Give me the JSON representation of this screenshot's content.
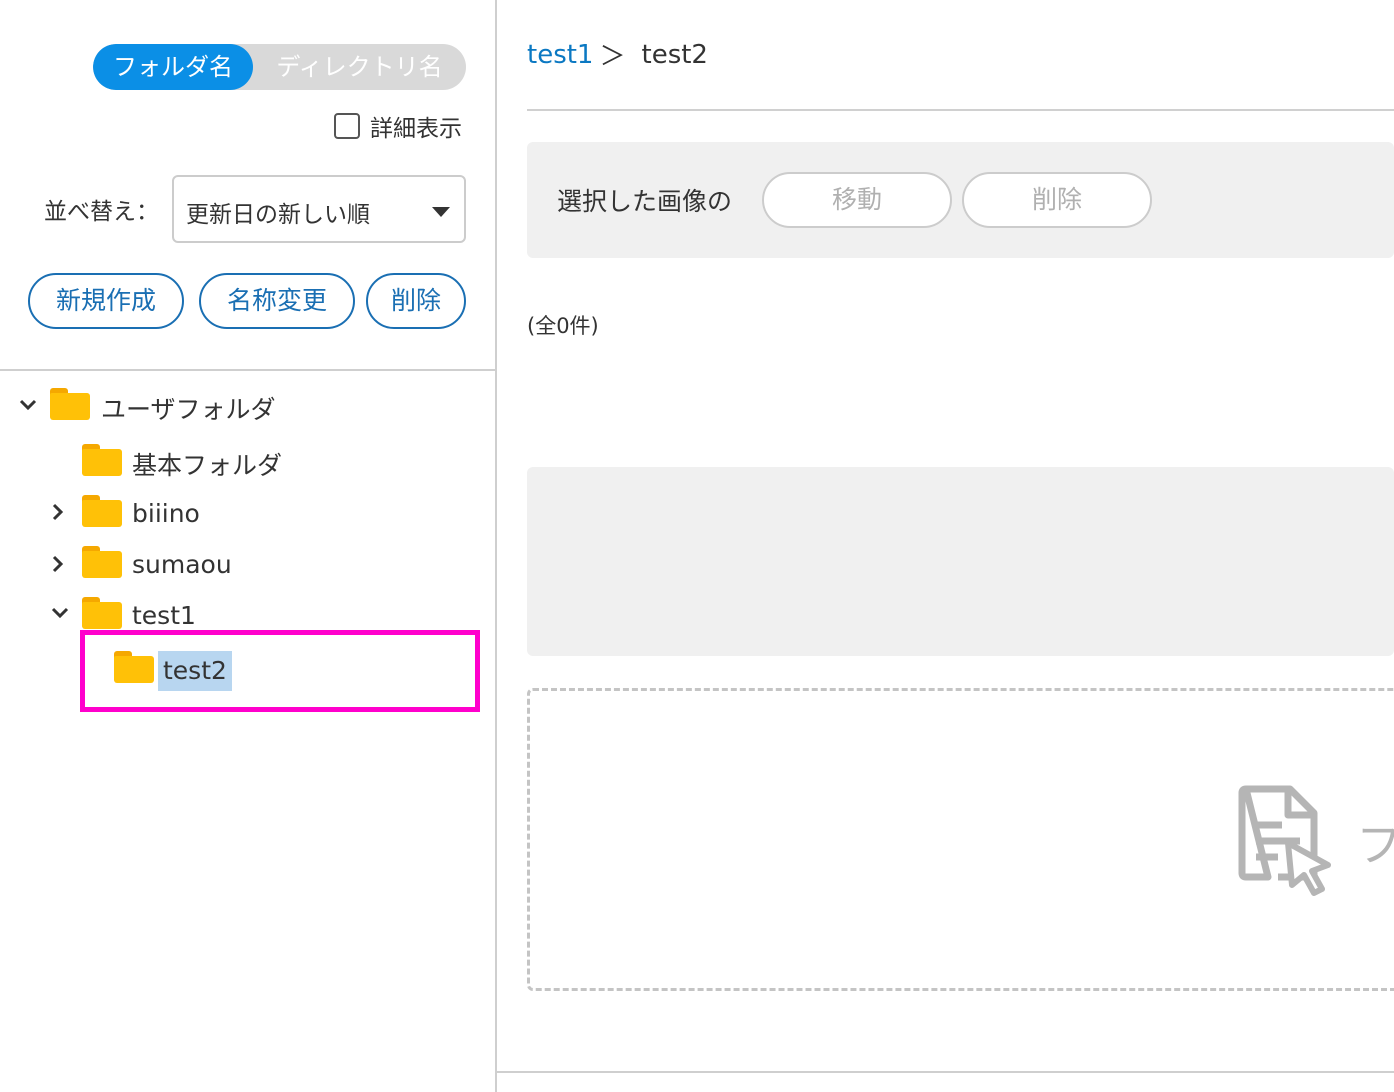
{
  "sidebar": {
    "toggle": {
      "active_label": "フォルダ名",
      "inactive_label": "ディレクトリ名"
    },
    "detail_checkbox": {
      "label": "詳細表示",
      "checked": false
    },
    "sort": {
      "label": "並べ替え：",
      "value": "更新日の新しい順"
    },
    "buttons": {
      "new": "新規作成",
      "rename": "名称変更",
      "delete": "削除"
    },
    "tree": {
      "root": "ユーザフォルダ",
      "basic": "基本フォルダ",
      "biiino": "biiino",
      "sumaou": "sumaou",
      "test1": "test1",
      "test2": "test2"
    }
  },
  "main": {
    "breadcrumb": {
      "parent": "test1",
      "separator": "＞",
      "current": "test2"
    },
    "action_bar": {
      "label": "選択した画像の",
      "move": "移動",
      "delete": "削除"
    },
    "count": "(全0件)",
    "dropzone": {
      "text": "フ"
    }
  },
  "colors": {
    "accent": "#0b8fe6",
    "button_outline": "#1a6fb3",
    "folder": "#ffc107",
    "selection": "#b8d6f0",
    "highlight_box": "#ff00cc"
  }
}
